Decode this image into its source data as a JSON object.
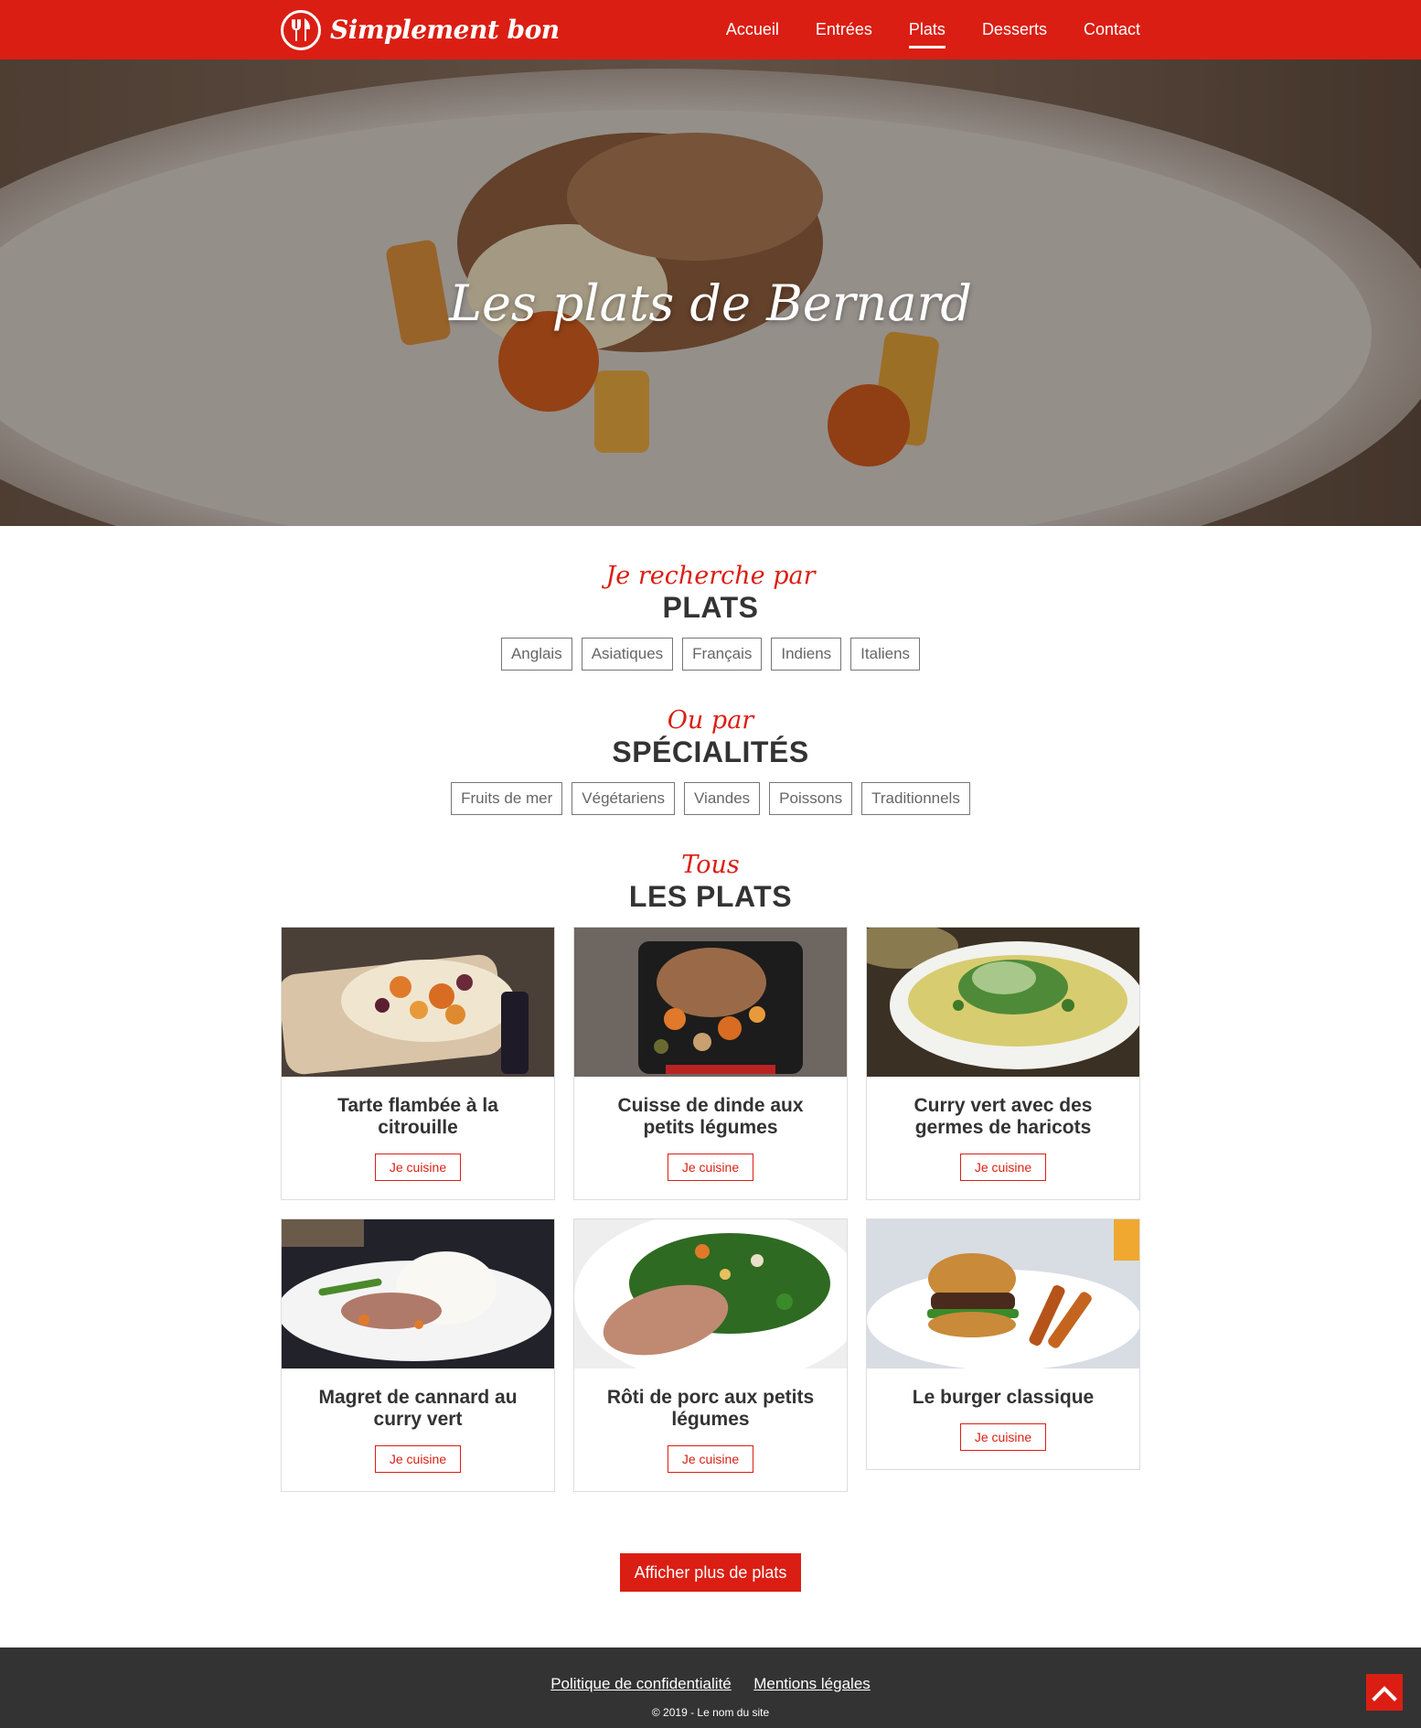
{
  "header": {
    "logo_text": "Simplement bon",
    "nav": [
      "Accueil",
      "Entrées",
      "Plats",
      "Desserts",
      "Contact"
    ],
    "active": "Plats"
  },
  "hero": {
    "title": "Les plats de Bernard"
  },
  "search": {
    "script": "Je recherche par",
    "caps": "PLATS",
    "filters": [
      "Anglais",
      "Asiatiques",
      "Français",
      "Indiens",
      "Italiens"
    ]
  },
  "specialities": {
    "script": "Ou par",
    "caps": "SPÉCIALITÉS",
    "filters": [
      "Fruits de mer",
      "Végétariens",
      "Viandes",
      "Poissons",
      "Traditionnels"
    ]
  },
  "all": {
    "script": "Tous",
    "caps": "LES PLATS",
    "cards": [
      {
        "title": "Tarte flambée à la citrouille",
        "button": "Je cuisine"
      },
      {
        "title": "Cuisse de dinde aux petits légumes",
        "button": "Je cuisine"
      },
      {
        "title": "Curry vert avec des germes de haricots",
        "button": "Je cuisine"
      },
      {
        "title": "Magret de cannard au curry vert",
        "button": "Je cuisine"
      },
      {
        "title": "Rôti de porc aux petits légumes",
        "button": "Je cuisine"
      },
      {
        "title": "Le burger classique",
        "button": "Je cuisine"
      }
    ]
  },
  "more_button": "Afficher plus de plats",
  "footer": {
    "links": [
      "Politique de confidentialité",
      "Mentions légales"
    ],
    "copyright": "© 2019 - Le nom du site"
  },
  "colors": {
    "accent": "#db1e13",
    "footer": "#333333"
  }
}
